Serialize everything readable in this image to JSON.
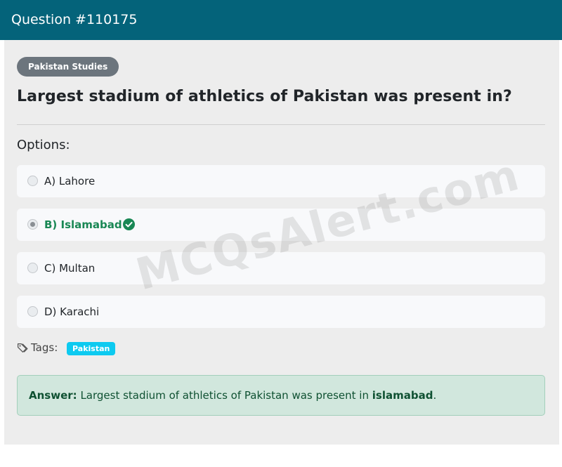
{
  "header": {
    "title": "Question #110175"
  },
  "question": {
    "subject": "Pakistan Studies",
    "text": "Largest stadium of athletics of Pakistan was present in?",
    "options_label": "Options:",
    "options": [
      {
        "label": "A) Lahore",
        "selected": false,
        "correct": false
      },
      {
        "label": "B) Islamabad",
        "selected": true,
        "correct": true
      },
      {
        "label": "C) Multan",
        "selected": false,
        "correct": false
      },
      {
        "label": "D) Karachi",
        "selected": false,
        "correct": false
      }
    ]
  },
  "tags": {
    "label": "Tags:",
    "items": [
      "Pakistan"
    ]
  },
  "answer": {
    "prefix": "Answer:",
    "sentence": "Largest stadium of athletics of Pakistan was present in",
    "highlight": "islamabad",
    "suffix": "."
  },
  "watermark": "MCQsAlert.com",
  "colors": {
    "header_bg": "#04637a",
    "correct_green": "#198754",
    "tag_badge": "#0dcaf0",
    "subject_badge": "#6c757d",
    "answer_bg": "#d1e7dd"
  },
  "icons": {
    "correct": "check-circle-icon",
    "tags": "tags-icon"
  }
}
